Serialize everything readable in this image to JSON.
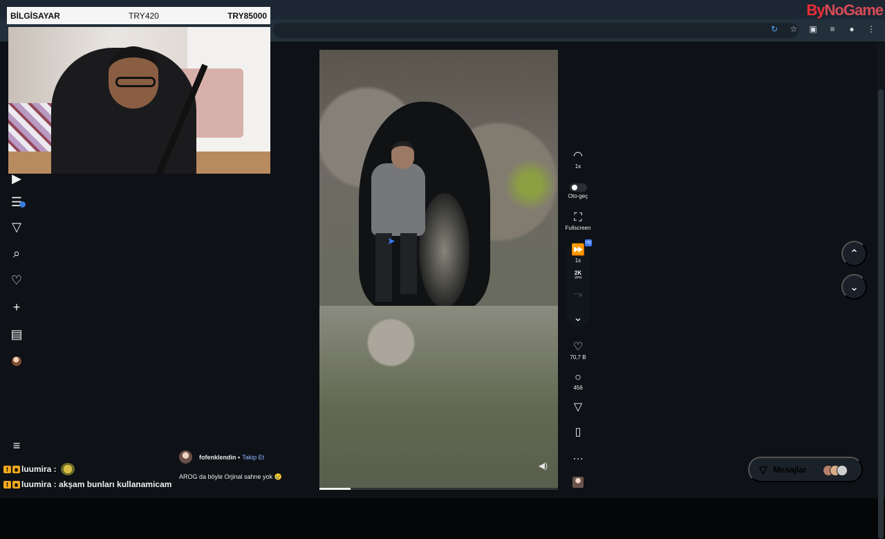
{
  "browser": {
    "toolbar_icons": [
      "extension-icon",
      "star-icon",
      "puzzle-icon",
      "menu-icon",
      "profile-icon",
      "more-icon"
    ]
  },
  "logo": {
    "text_primary": "By",
    "text_secondary": "NoGame"
  },
  "stream_overlay": {
    "left_label": "BİLGİSAYAR",
    "middle_value": "TRY420",
    "right_value": "TRY85000"
  },
  "left_nav": {
    "items": [
      {
        "icon": "play-icon"
      },
      {
        "icon": "list-icon",
        "badge": ""
      },
      {
        "icon": "send-icon"
      },
      {
        "icon": "search-icon"
      },
      {
        "icon": "heart-icon"
      },
      {
        "icon": "plus-icon"
      },
      {
        "icon": "chart-icon"
      },
      {
        "icon": "avatar-icon"
      }
    ],
    "menu_icon": "menu-icon"
  },
  "video": {
    "progress": 0.13,
    "sound_icon": "sound-icon"
  },
  "side_controls": {
    "speed_label": "1x",
    "autoplay_label": "Oto-geç",
    "fullscreen_label": "Fullscreen",
    "playback_label": "1x",
    "bitrate_top": "2K",
    "bitrate_bottom": "VPH",
    "likes": "70,7 B",
    "comments": "456"
  },
  "chat": {
    "lines": [
      {
        "user": "luumira",
        "message": ""
      },
      {
        "user": "luumira",
        "message": "akşam bunları kullanamicam"
      }
    ]
  },
  "comment": {
    "author": "fofenklendin",
    "follow": "Takip Et",
    "text": "AROG da böyle Orjinal sahne yok 😢"
  },
  "messages": {
    "label": "Mesajlar"
  },
  "colors": {
    "accent_blue": "#3f7bff",
    "logo_red": "#ef2d37",
    "overlay_yellow": "#f3a91d"
  }
}
